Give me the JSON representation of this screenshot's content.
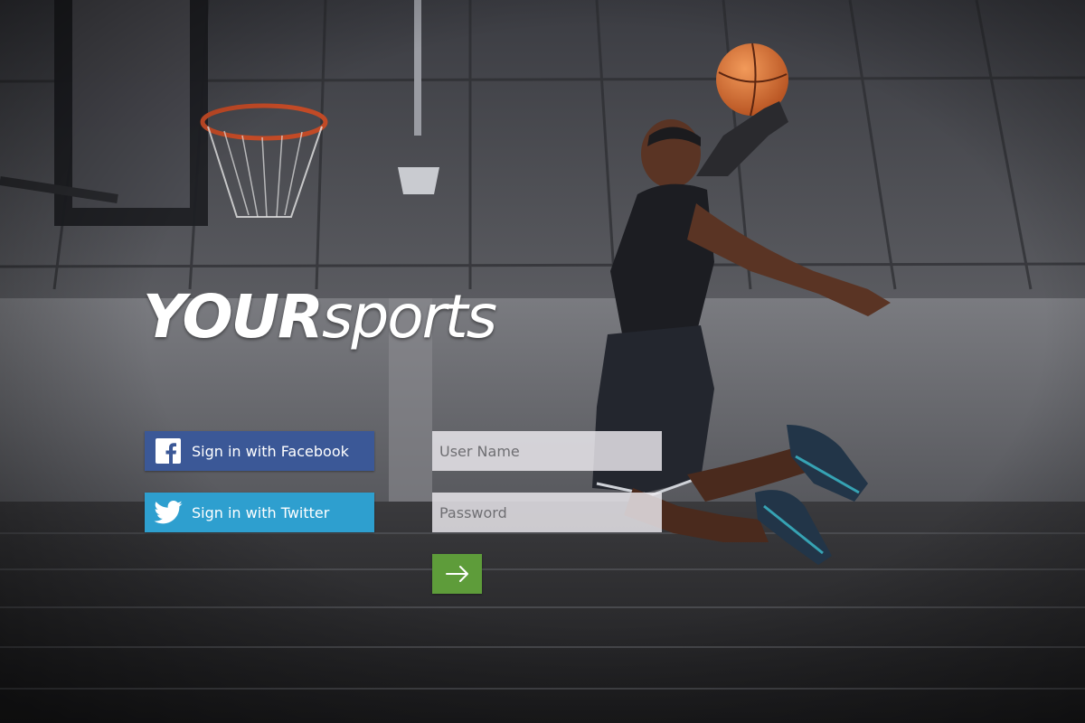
{
  "brand": {
    "part1": "YOUR",
    "part2": "sports"
  },
  "login": {
    "facebook_label": "Sign in with Facebook",
    "twitter_label": "Sign in with Twitter",
    "username_placeholder": "User Name",
    "password_placeholder": "Password",
    "submit_icon": "arrow-right-icon"
  },
  "icons": {
    "facebook": "facebook-icon",
    "twitter": "twitter-icon"
  },
  "colors": {
    "facebook": "#3b5897",
    "twitter": "#2e9fcf",
    "submit": "#5e9c3a",
    "field_bg": "#eeecf0"
  }
}
